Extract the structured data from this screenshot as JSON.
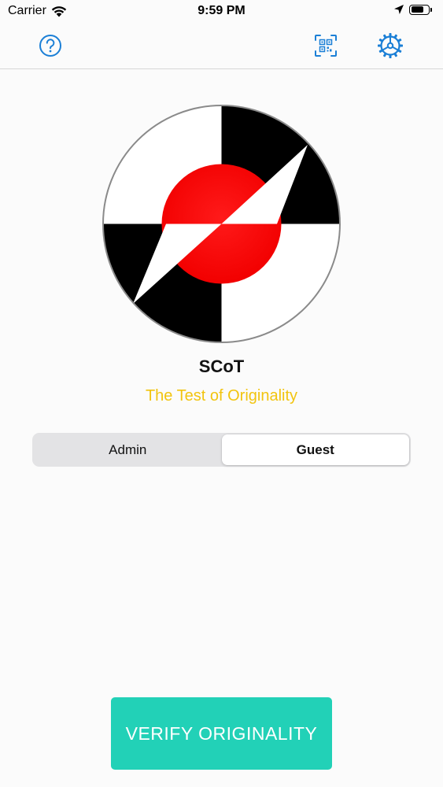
{
  "status_bar": {
    "carrier": "Carrier",
    "time": "9:59 PM",
    "battery_level": 0.75
  },
  "nav": {
    "left_icon": "help-icon",
    "right_icons": [
      "qr-code-icon",
      "settings-gear-icon"
    ],
    "accent_color": "#1b7fd6"
  },
  "app": {
    "name": "SCoT",
    "tagline": "The Test of Originality",
    "tagline_color": "#f2c40f"
  },
  "segmented_control": {
    "options": [
      "Admin",
      "Guest"
    ],
    "selected": "Guest"
  },
  "verify_button": {
    "label": "VERIFY ORIGINALITY",
    "color": "#22d1b7"
  }
}
